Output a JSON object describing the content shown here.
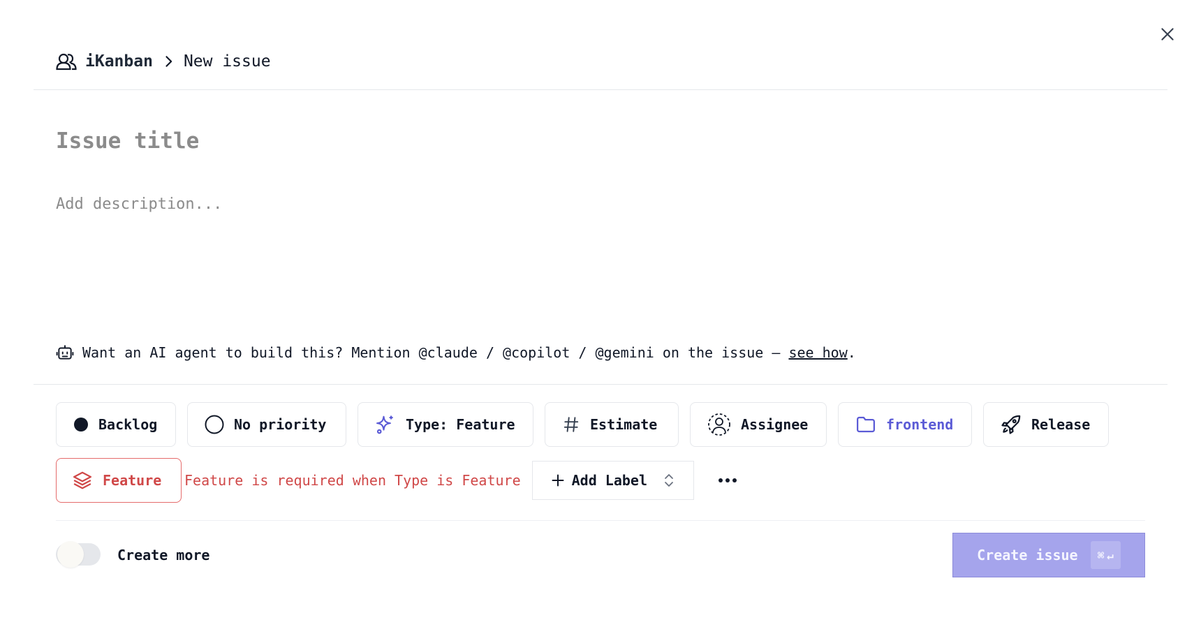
{
  "header": {
    "workspace": "iKanban",
    "page": "New issue"
  },
  "form": {
    "title_placeholder": "Issue title",
    "description_placeholder": "Add description..."
  },
  "ai_hint": {
    "text": "Want an AI agent to build this? Mention @claude / @copilot / @gemini on the issue — ",
    "link": "see how",
    "suffix": "."
  },
  "properties": {
    "status": "Backlog",
    "priority": "No priority",
    "type": "Type: Feature",
    "estimate": "Estimate",
    "assignee": "Assignee",
    "project": "frontend",
    "release": "Release"
  },
  "feature": {
    "label": "Feature",
    "error": "Feature is required when Type is Feature"
  },
  "add_label": "Add Label",
  "footer": {
    "create_more": "Create more",
    "create_more_on": false,
    "create_button": "Create issue",
    "shortcut_cmd": "⌘",
    "shortcut_enter": "↵"
  },
  "colors": {
    "accent": "#a5a4ec",
    "error": "#d04848",
    "project": "#5b5bd6"
  },
  "icons": {
    "close": "close-icon",
    "team": "team-icon",
    "chevron": "chevron-right-icon",
    "robot": "robot-icon",
    "status": "filled-circle-icon",
    "priority": "empty-circle-icon",
    "type": "sparkles-icon",
    "estimate": "hash-icon",
    "assignee": "user-circle-icon",
    "project": "folder-icon",
    "release": "rocket-icon",
    "feature": "layers-icon",
    "add": "plus-icon",
    "select": "chevron-up-down-icon",
    "more": "ellipsis-icon"
  }
}
